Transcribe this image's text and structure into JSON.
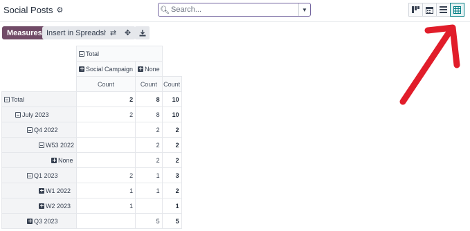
{
  "header": {
    "title": "Social Posts",
    "search_placeholder": "Search...",
    "views": [
      "kanban-icon",
      "calendar-icon",
      "list-icon",
      "pivot-icon"
    ],
    "active_view": "pivot-icon"
  },
  "control_panel": {
    "measures_label": "Measures",
    "insert_label": "Insert in Spreadsheet",
    "icons": [
      "flip-axis-icon",
      "expand-all-icon",
      "download-icon"
    ]
  },
  "pivot": {
    "col_header": {
      "total": "Total",
      "groups": [
        "Social Campaign",
        "None"
      ],
      "measure": "Count"
    },
    "rows": [
      {
        "label": "Total",
        "toggle": "minus",
        "values": [
          "2",
          "8",
          "10"
        ]
      },
      {
        "label": "July 2023",
        "toggle": "minus",
        "values": [
          "2",
          "8",
          "10"
        ]
      },
      {
        "label": "Q4 2022",
        "toggle": "minus",
        "values": [
          "",
          "2",
          "2"
        ]
      },
      {
        "label": "W53 2022",
        "toggle": "minus",
        "values": [
          "",
          "2",
          "2"
        ]
      },
      {
        "label": "None",
        "toggle": "plus",
        "values": [
          "",
          "2",
          "2"
        ]
      },
      {
        "label": "Q1 2023",
        "toggle": "minus",
        "values": [
          "2",
          "1",
          "3"
        ]
      },
      {
        "label": "W1 2022",
        "toggle": "plus",
        "values": [
          "1",
          "1",
          "2"
        ]
      },
      {
        "label": "W2 2023",
        "toggle": "plus",
        "values": [
          "1",
          "",
          "1"
        ]
      },
      {
        "label": "Q3 2023",
        "toggle": "plus",
        "values": [
          "",
          "5",
          "5"
        ]
      }
    ]
  },
  "colors": {
    "brand": "#714b67",
    "active_view": "#017e84",
    "annotation_arrow": "#e11d2a"
  }
}
